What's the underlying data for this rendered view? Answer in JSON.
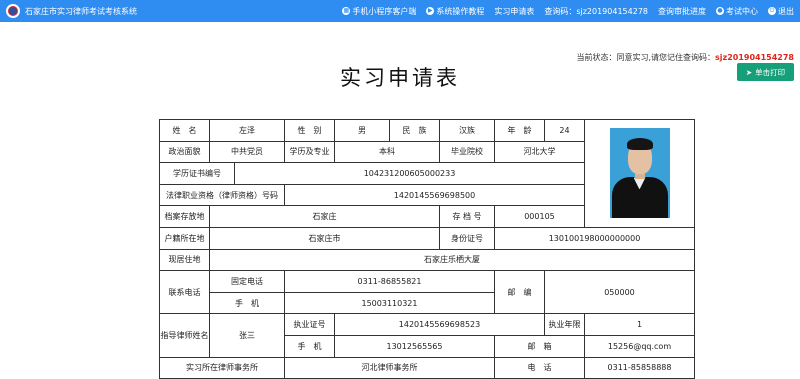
{
  "header": {
    "title": "石家庄市实习律师考试考核系统",
    "nav": [
      {
        "label": "手机小程序客户端",
        "icon": "qrcode-icon"
      },
      {
        "label": "系统操作教程",
        "icon": "play-icon"
      },
      {
        "label": "实习申请表",
        "icon": ""
      },
      {
        "label": "查询码：sjz201904154278",
        "icon": ""
      },
      {
        "label": "查询审批进度",
        "icon": ""
      },
      {
        "label": "考试中心",
        "icon": "user-icon"
      },
      {
        "label": "退出",
        "icon": "power-icon"
      }
    ]
  },
  "status": {
    "prefix": "当前状态：同意实习,请您记住查询码：",
    "code": "sjz201904154278"
  },
  "print_button": {
    "label": "单击打印",
    "icon": "send-icon"
  },
  "page_title": "实习申请表",
  "form": {
    "row1": {
      "name_label": "姓　名",
      "name": "左泽",
      "gender_label": "性　别",
      "gender": "男",
      "ethnicity_label": "民　族",
      "ethnicity": "汉族",
      "age_label": "年　龄",
      "age": "24"
    },
    "row2": {
      "political_label": "政治面貌",
      "political": "中共党员",
      "education_label": "学历及专业",
      "education": "本科",
      "school_label": "毕业院校",
      "school": "河北大学"
    },
    "row3": {
      "label": "学历证书编号",
      "value": "104231200605000233"
    },
    "row4": {
      "label": "法律职业资格（律师资格）号码",
      "value": "1420145569698500"
    },
    "row5": {
      "archive_label": "档案存放地",
      "archive": "石家庄",
      "file_no_label": "存 档 号",
      "file_no": "000105"
    },
    "row6": {
      "hukou_label": "户籍所在地",
      "hukou": "石家庄市",
      "id_label": "身份证号",
      "id": "130100198000000000"
    },
    "row7": {
      "residence_label": "现居住地",
      "residence": "石家庄乐栖大厦"
    },
    "contact": {
      "label": "联系电话",
      "landline_label": "固定电话",
      "landline": "0311-86855821",
      "mobile_label": "手　机",
      "mobile": "15003110321",
      "postcode_label": "邮　编",
      "postcode": "050000"
    },
    "mentor": {
      "label": "指导律师姓名",
      "name": "张三",
      "license_label": "执业证号",
      "license": "1420145569698523",
      "years_label": "执业年限",
      "years": "1",
      "mobile_label": "手　机",
      "mobile": "13012565565",
      "email_label": "邮　箱",
      "email": "15256@qq.com"
    },
    "last_row": {
      "firm_label": "实习所在律师事务所",
      "firm": "河北律师事务所",
      "phone_label": "电　话",
      "phone": "0311-85858888"
    }
  }
}
